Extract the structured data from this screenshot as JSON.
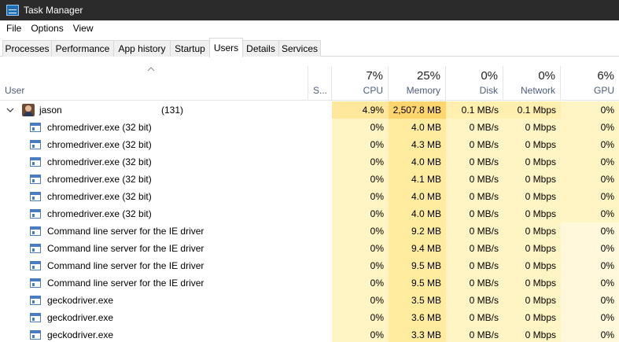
{
  "window": {
    "title": "Task Manager"
  },
  "menu": [
    "File",
    "Options",
    "View"
  ],
  "tabs": [
    "Processes",
    "Performance",
    "App history",
    "Startup",
    "Users",
    "Details",
    "Services"
  ],
  "active_tab": "Users",
  "header": {
    "user_label": "User",
    "status_label": "S...",
    "cpu": {
      "pct": "7%",
      "label": "CPU"
    },
    "memory": {
      "pct": "25%",
      "label": "Memory"
    },
    "disk": {
      "pct": "0%",
      "label": "Disk"
    },
    "network": {
      "pct": "0%",
      "label": "Network"
    },
    "gpu": {
      "pct": "6%",
      "label": "GPU"
    }
  },
  "user_row": {
    "name": "jason",
    "count": "(131)",
    "cpu": "4.9%",
    "memory": "2,507.8 MB",
    "disk": "0.1 MB/s",
    "network": "0.1 Mbps",
    "gpu": "0%"
  },
  "processes": [
    {
      "name": "chromedriver.exe (32 bit)",
      "cpu": "0%",
      "memory": "4.0 MB",
      "disk": "0 MB/s",
      "network": "0 Mbps",
      "gpu": "0%"
    },
    {
      "name": "chromedriver.exe (32 bit)",
      "cpu": "0%",
      "memory": "4.3 MB",
      "disk": "0 MB/s",
      "network": "0 Mbps",
      "gpu": "0%"
    },
    {
      "name": "chromedriver.exe (32 bit)",
      "cpu": "0%",
      "memory": "4.0 MB",
      "disk": "0 MB/s",
      "network": "0 Mbps",
      "gpu": "0%"
    },
    {
      "name": "chromedriver.exe (32 bit)",
      "cpu": "0%",
      "memory": "4.1 MB",
      "disk": "0 MB/s",
      "network": "0 Mbps",
      "gpu": "0%"
    },
    {
      "name": "chromedriver.exe (32 bit)",
      "cpu": "0%",
      "memory": "4.0 MB",
      "disk": "0 MB/s",
      "network": "0 Mbps",
      "gpu": "0%"
    },
    {
      "name": "chromedriver.exe (32 bit)",
      "cpu": "0%",
      "memory": "4.0 MB",
      "disk": "0 MB/s",
      "network": "0 Mbps",
      "gpu": "0%"
    },
    {
      "name": "Command line server for the IE driver",
      "cpu": "0%",
      "memory": "9.2 MB",
      "disk": "0 MB/s",
      "network": "0 Mbps",
      "gpu": "0%"
    },
    {
      "name": "Command line server for the IE driver",
      "cpu": "0%",
      "memory": "9.4 MB",
      "disk": "0 MB/s",
      "network": "0 Mbps",
      "gpu": "0%"
    },
    {
      "name": "Command line server for the IE driver",
      "cpu": "0%",
      "memory": "9.5 MB",
      "disk": "0 MB/s",
      "network": "0 Mbps",
      "gpu": "0%"
    },
    {
      "name": "Command line server for the IE driver",
      "cpu": "0%",
      "memory": "9.5 MB",
      "disk": "0 MB/s",
      "network": "0 Mbps",
      "gpu": "0%"
    },
    {
      "name": "geckodriver.exe",
      "cpu": "0%",
      "memory": "3.5 MB",
      "disk": "0 MB/s",
      "network": "0 Mbps",
      "gpu": "0%"
    },
    {
      "name": "geckodriver.exe",
      "cpu": "0%",
      "memory": "3.6 MB",
      "disk": "0 MB/s",
      "network": "0 Mbps",
      "gpu": "0%"
    },
    {
      "name": "geckodriver.exe",
      "cpu": "0%",
      "memory": "3.3 MB",
      "disk": "0 MB/s",
      "network": "0 Mbps",
      "gpu": "0%"
    }
  ],
  "colors": {
    "titlebar_bg": "#2b2b2b",
    "heat_light": "#fff4c4",
    "heat_mid": "#ffe79b",
    "header_label": "#4c5c7c"
  },
  "icons": {
    "app": "task-manager-icon",
    "expand": "chevron-down-icon",
    "sort": "sort-up-icon",
    "process": "window-app-icon",
    "user": "user-avatar"
  }
}
